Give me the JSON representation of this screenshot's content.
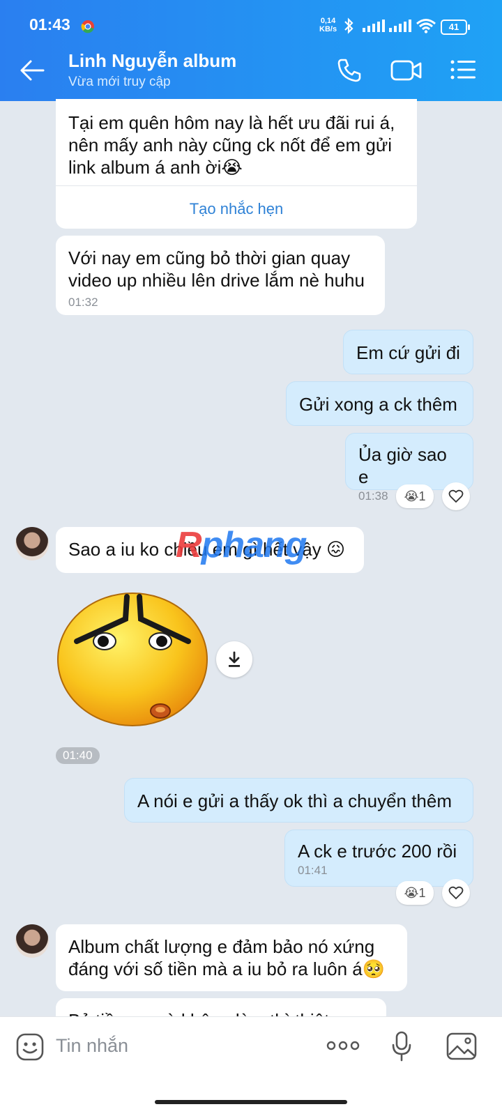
{
  "status_bar": {
    "time": "01:43",
    "net_speed_value": "0,14",
    "net_speed_unit": "KB/s",
    "battery": "41"
  },
  "header": {
    "title": "Linh Nguyễn album",
    "subtitle": "Vừa mới truy cập",
    "icons": [
      "back-arrow-icon",
      "phone-icon",
      "video-call-icon",
      "menu-icon"
    ]
  },
  "messages": {
    "m1": {
      "text_lines": [
        "Tại em quên hôm nay là hết ưu đãi rui á,",
        "nên mấy anh này cũng ck nốt để em gửi",
        "link album á anh ời😭"
      ],
      "action": "Tạo nhắc hẹn"
    },
    "m2": {
      "text_lines": [
        "Với nay em cũng bỏ thời gian quay",
        "video up nhiều lên drive lắm nè huhu"
      ],
      "time": "01:32"
    },
    "m3": {
      "text": "Em cứ gửi đi"
    },
    "m4": {
      "text": "Gửi xong a ck thêm"
    },
    "m5": {
      "text": "Ủa giờ sao e",
      "time": "01:38",
      "reaction": "😭1"
    },
    "m6": {
      "text": "Sao a iu ko chiều em gì hết vậy 😖"
    },
    "m7": {
      "sticker": "sad-face-sticker",
      "time": "01:40"
    },
    "m8": {
      "text": "A nói e gửi a thấy ok thì a chuyển thêm"
    },
    "m9": {
      "text": "A ck e trước 200 rồi",
      "time": "01:41",
      "reaction": "😭1"
    },
    "m10": {
      "text_lines": [
        "Album chất lượng e đảm bảo nó xứng",
        "đáng với số tiền mà a iu bỏ ra luôn á🥺"
      ]
    },
    "m11": {
      "text": "Bỏ tiền ra mà không làm thì thiệt em 😢"
    }
  },
  "watermark": {
    "prefix": "R",
    "rest": "phang"
  },
  "composer": {
    "placeholder": "Tin nhắn"
  },
  "colors": {
    "header_start": "#2a7ff0",
    "header_end": "#1fa2f5",
    "outgoing": "#d4ecfd",
    "incoming": "#ffffff",
    "background": "#e2e8ef",
    "link": "#2f82d6"
  }
}
